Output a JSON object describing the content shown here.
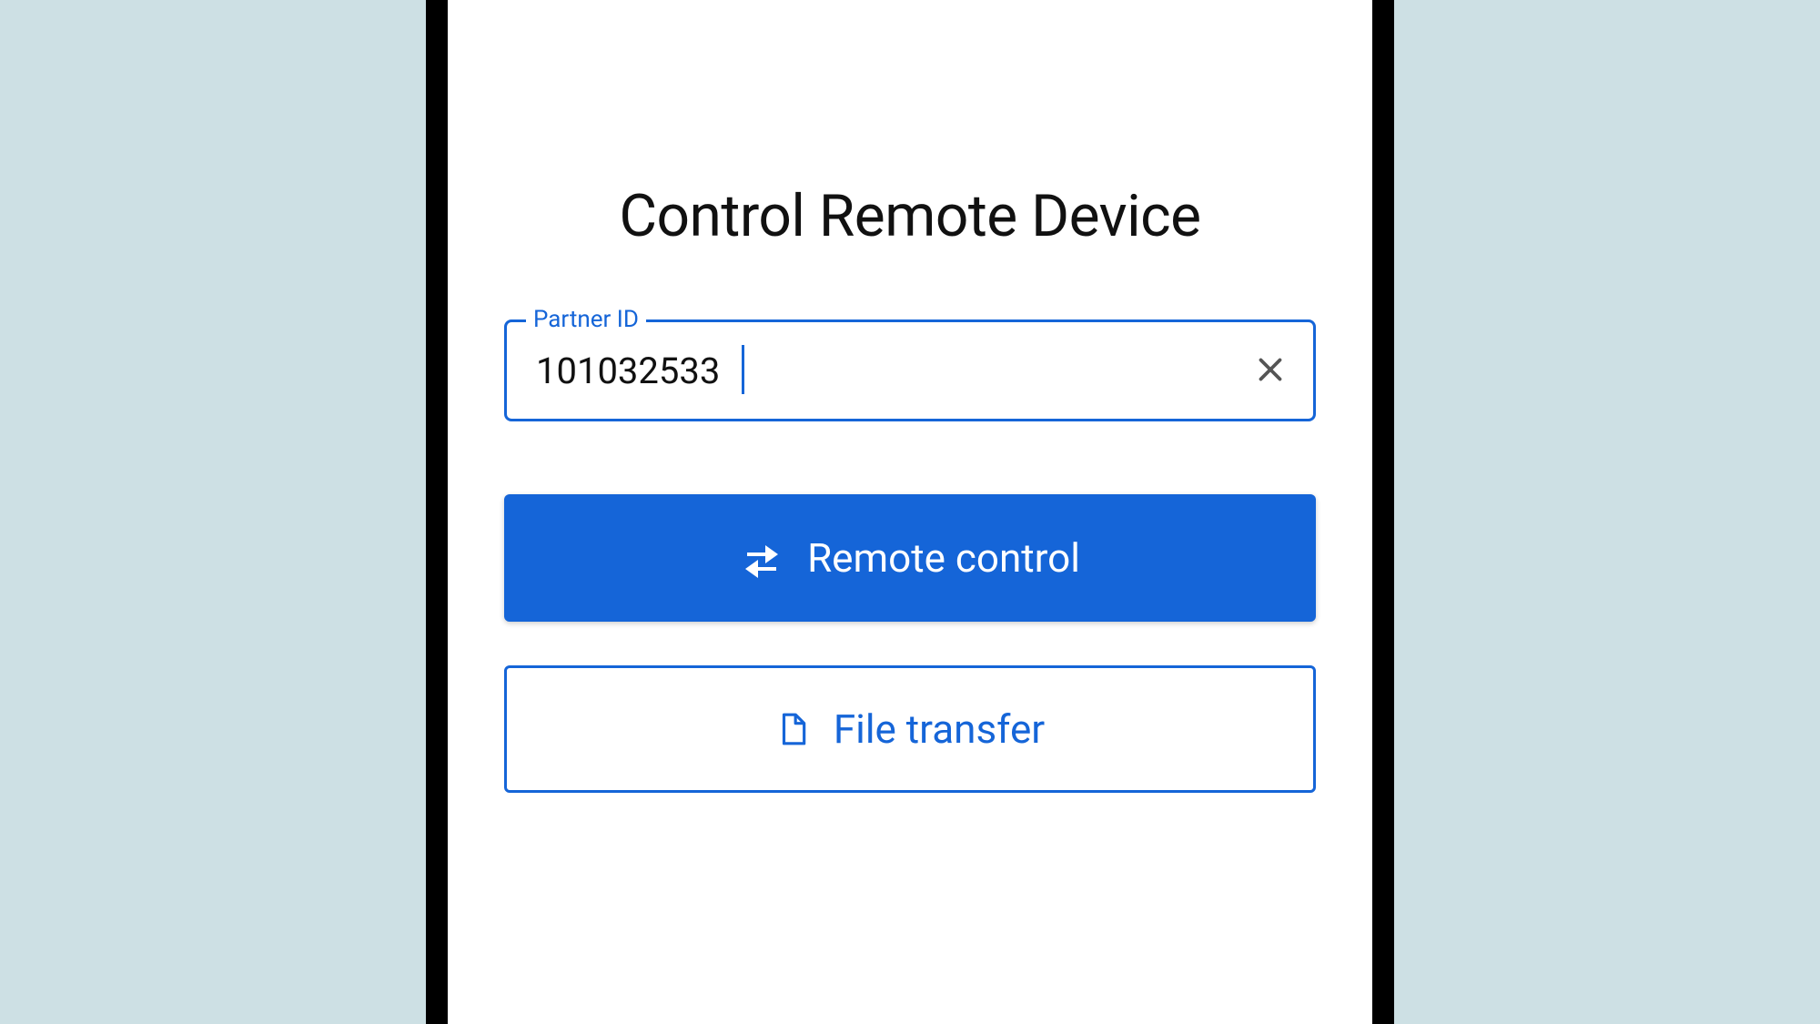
{
  "header": {
    "title": "Control Remote Device"
  },
  "input": {
    "label": "Partner ID",
    "value": "101032533"
  },
  "buttons": {
    "remote_control": "Remote control",
    "file_transfer": "File transfer"
  },
  "colors": {
    "accent": "#1565d8",
    "background": "#cde0e4"
  }
}
